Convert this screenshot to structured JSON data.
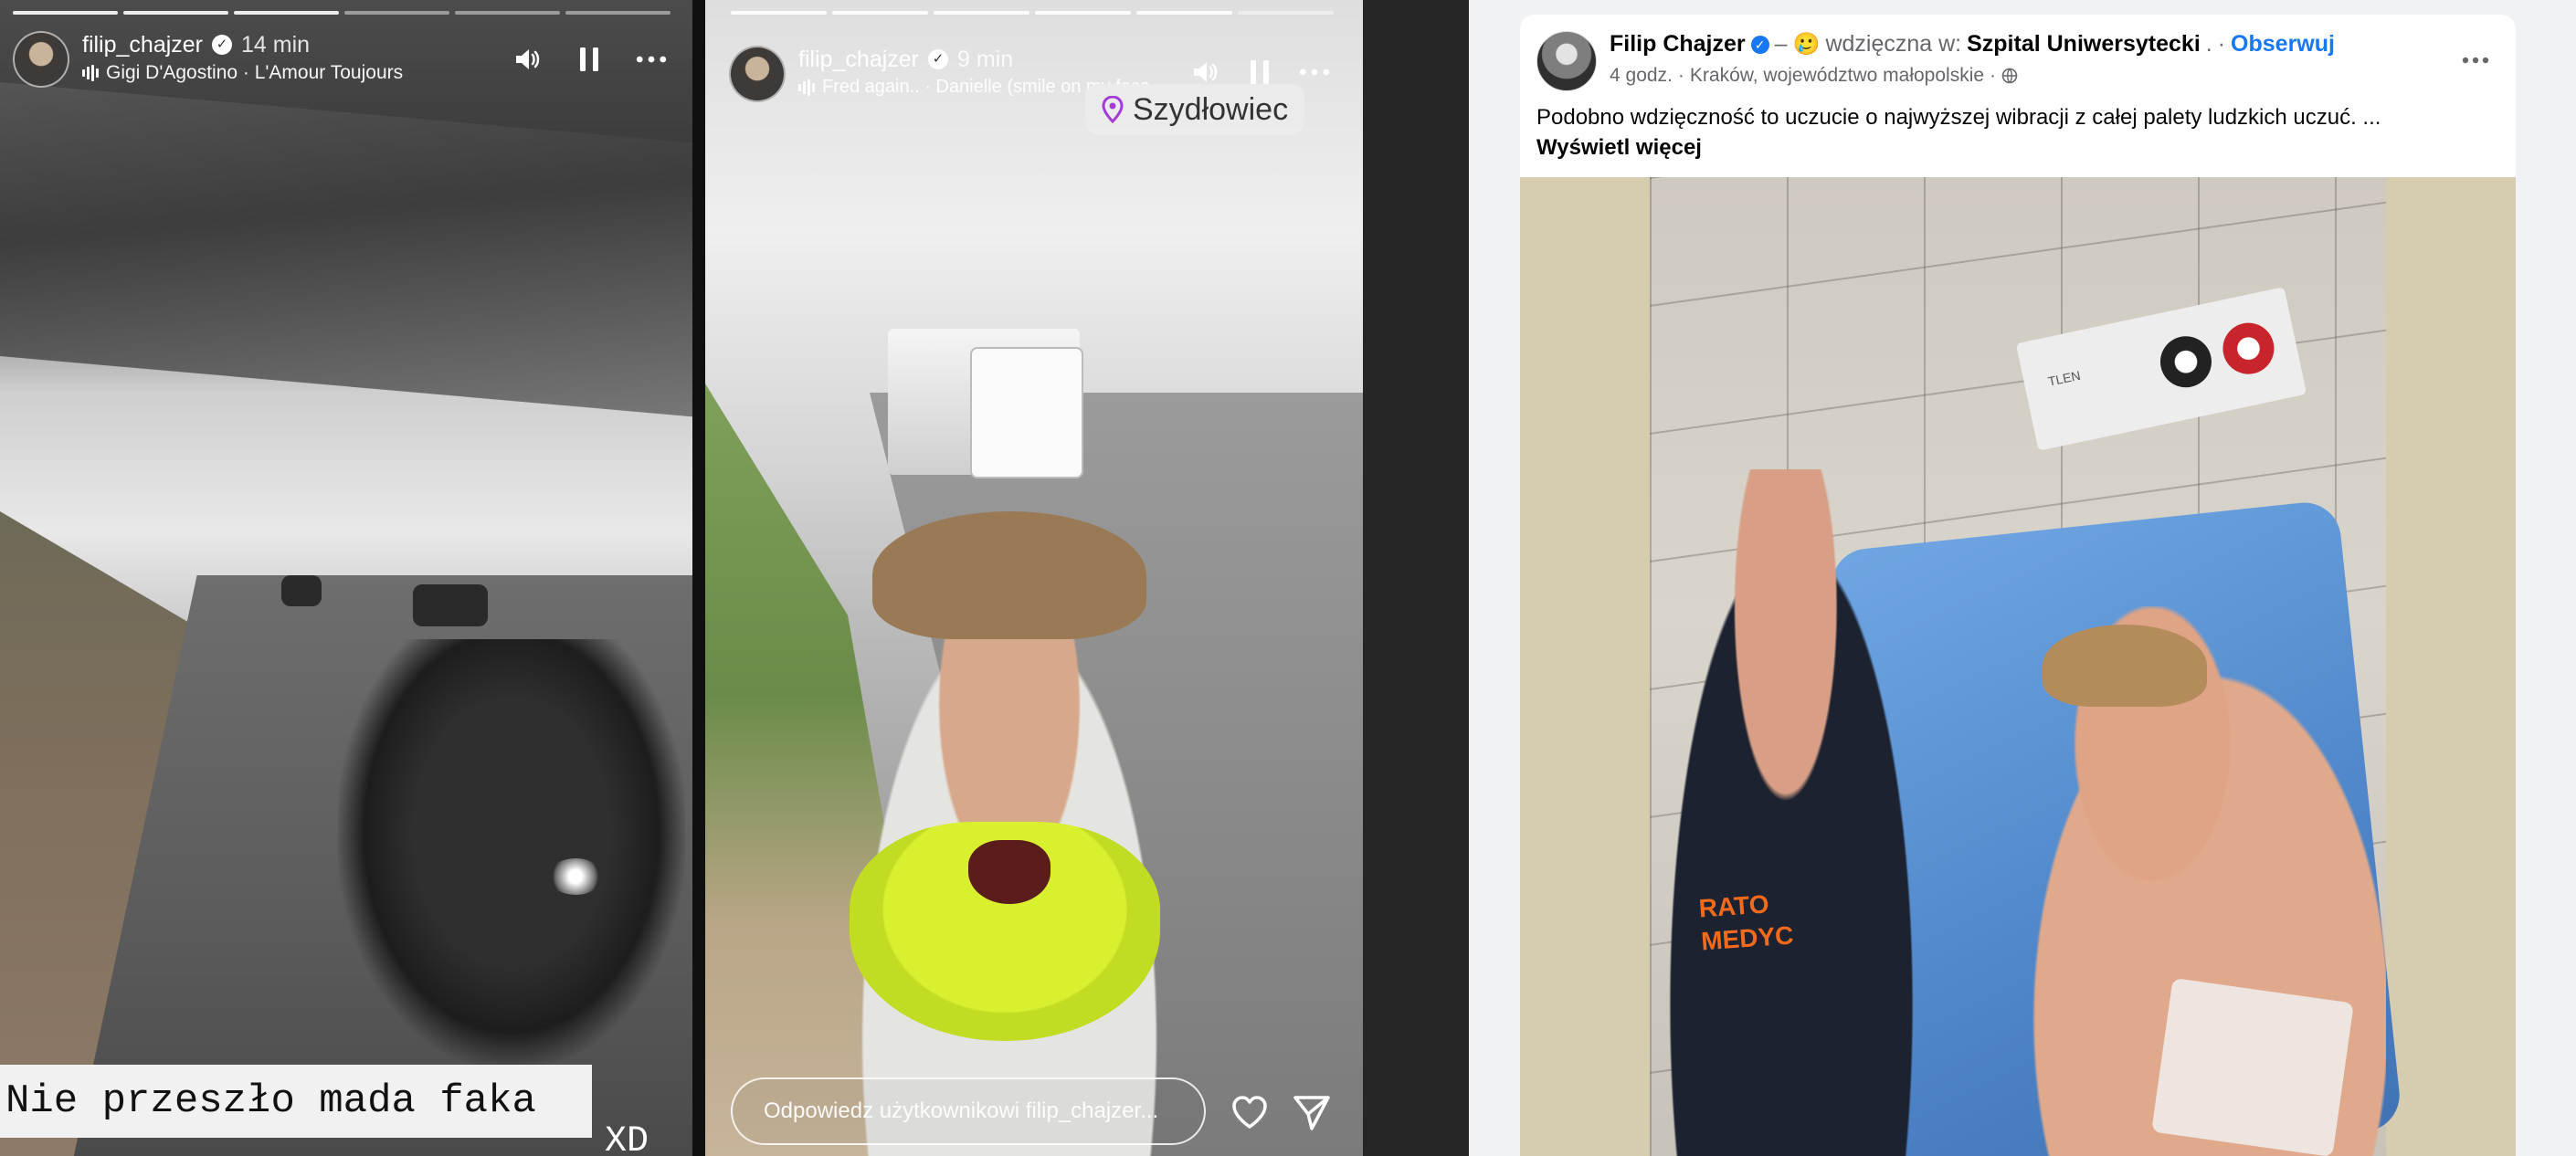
{
  "story1": {
    "username": "filip_chajzer",
    "time": "14 min",
    "music": "Gigi D'Agostino · L'Amour Toujours",
    "caption": "Nie przeszło mada faka",
    "caption_suffix": "XD",
    "progress": {
      "total": 6,
      "done": 3
    }
  },
  "story2": {
    "username": "filip_chajzer",
    "time": "9 min",
    "music": "Fred again.. · Danielle (smile on my face",
    "location": "Szydłowiec",
    "reply_placeholder": "Odpowiedz użytkownikowi filip_chajzer...",
    "progress": {
      "total": 6,
      "done": 5
    }
  },
  "icons": {
    "sound": "speaker-icon",
    "pause": "pause-icon",
    "more": "more-horizontal-icon",
    "heart": "heart-icon",
    "send": "paper-plane-icon",
    "location": "location-pin-icon",
    "globe": "globe-icon"
  },
  "facebook": {
    "author": "Filip Chajzer",
    "separator": "–",
    "feeling_emoji": "🥲",
    "feeling_text": "wdzięczna w:",
    "place": "Szpital Uniwersytecki",
    "dot": ".",
    "follow_label": "Obserwuj",
    "time": "4 godz.",
    "location": "Kraków, województwo małopolskie",
    "post_text": "Podobno wdzięczność to uczucie o najwyższej wibracji z całej palety ludzkich uczuć. ...",
    "see_more": "Wyświetl więcej",
    "photo_text": [
      "RATO",
      "MEDYC"
    ],
    "panel_label": "TLEN"
  },
  "colors": {
    "fb_blue": "#1877f2",
    "fb_text": "#050505",
    "fb_gray": "#65676b",
    "scarf": "#d4ec2a",
    "medic_orange": "#f26a1b"
  }
}
